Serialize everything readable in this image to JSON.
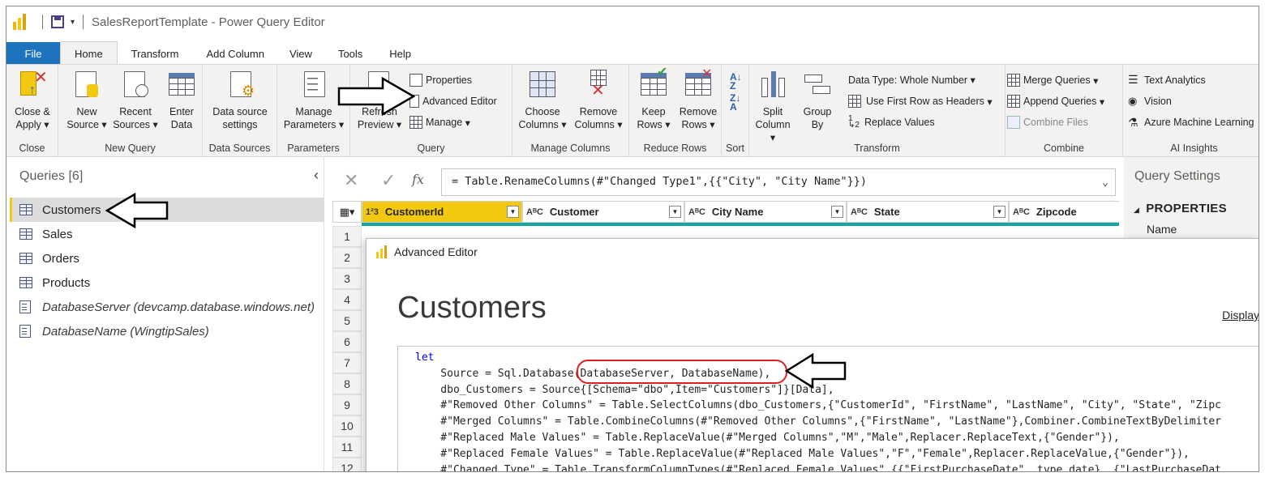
{
  "window": {
    "title": "SalesReportTemplate - Power Query Editor"
  },
  "tabs": [
    "File",
    "Home",
    "Transform",
    "Add Column",
    "View",
    "Tools",
    "Help"
  ],
  "active_tab": "Home",
  "ribbon": {
    "close": {
      "btn1": "Close &",
      "btn1b": "Apply",
      "label": "Close"
    },
    "new_query": {
      "new_source": "New",
      "new_source_b": "Source",
      "recent": "Recent",
      "recent_b": "Sources",
      "enter": "Enter",
      "enter_b": "Data",
      "label": "New Query"
    },
    "data_sources": {
      "settings": "Data source",
      "settings_b": "settings",
      "label": "Data Sources"
    },
    "parameters": {
      "manage": "Manage",
      "manage_b": "Parameters",
      "label": "Parameters"
    },
    "query": {
      "refresh": "Refresh",
      "refresh_b": "Preview",
      "properties": "Properties",
      "advanced_editor": "Advanced Editor",
      "manage": "Manage",
      "label": "Query"
    },
    "manage_columns": {
      "choose": "Choose",
      "choose_b": "Columns",
      "remove": "Remove",
      "remove_b": "Columns",
      "label": "Manage Columns"
    },
    "reduce_rows": {
      "keep": "Keep",
      "keep_b": "Rows",
      "remove": "Remove",
      "remove_b": "Rows",
      "label": "Reduce Rows"
    },
    "sort": {
      "label": "Sort"
    },
    "transform": {
      "split": "Split",
      "split_b": "Column",
      "group": "Group",
      "group_b": "By",
      "data_type": "Data Type: Whole Number",
      "first_row": "Use First Row as Headers",
      "replace": "Replace Values",
      "label": "Transform"
    },
    "combine": {
      "merge": "Merge Queries",
      "append": "Append Queries",
      "combine_files": "Combine Files",
      "label": "Combine"
    },
    "ai": {
      "text": "Text Analytics",
      "vision": "Vision",
      "aml": "Azure Machine Learning",
      "label": "AI Insights"
    }
  },
  "queries": {
    "title": "Queries [6]",
    "items": [
      {
        "name": "Customers",
        "type": "table"
      },
      {
        "name": "Sales",
        "type": "table"
      },
      {
        "name": "Orders",
        "type": "table"
      },
      {
        "name": "Products",
        "type": "table"
      },
      {
        "name": "DatabaseServer (devcamp.database.windows.net)",
        "type": "param"
      },
      {
        "name": "DatabaseName (WingtipSales)",
        "type": "param"
      }
    ]
  },
  "formula": "= Table.RenameColumns(#\"Changed Type1\",{{\"City\", \"City Name\"}})",
  "grid": {
    "columns": [
      {
        "type": "1²3",
        "name": "CustomerId"
      },
      {
        "type": "AᴮC",
        "name": "Customer"
      },
      {
        "type": "AᴮC",
        "name": "City Name"
      },
      {
        "type": "AᴮC",
        "name": "State"
      },
      {
        "type": "AᴮC",
        "name": "Zipcode"
      }
    ],
    "row_numbers": [
      "1",
      "2",
      "3",
      "4",
      "5",
      "6",
      "7",
      "8",
      "9",
      "10",
      "11",
      "12"
    ]
  },
  "query_settings": {
    "title": "Query Settings",
    "properties": "PROPERTIES",
    "name_label": "Name"
  },
  "advanced_editor": {
    "title": "Advanced Editor",
    "query_name": "Customers",
    "display": "Display",
    "code": [
      "let",
      "    Source = Sql.Database(DatabaseServer, DatabaseName),",
      "    dbo_Customers = Source{[Schema=\"dbo\",Item=\"Customers\"]}[Data],",
      "    #\"Removed Other Columns\" = Table.SelectColumns(dbo_Customers,{\"CustomerId\", \"FirstName\", \"LastName\", \"City\", \"State\", \"Zipc",
      "    #\"Merged Columns\" = Table.CombineColumns(#\"Removed Other Columns\",{\"FirstName\", \"LastName\"},Combiner.CombineTextByDelimiter",
      "    #\"Replaced Male Values\" = Table.ReplaceValue(#\"Merged Columns\",\"M\",\"Male\",Replacer.ReplaceText,{\"Gender\"}),",
      "    #\"Replaced Female Values\" = Table.ReplaceValue(#\"Replaced Male Values\",\"F\",\"Female\",Replacer.ReplaceValue,{\"Gender\"}),",
      "    #\"Changed Type\" = Table.TransformColumnTypes(#\"Replaced Female Values\",{{\"FirstPurchaseDate\", type date}, {\"LastPurchaseDat"
    ]
  },
  "colors": {
    "accent": "#f2c811",
    "file_tab": "#1e73be",
    "teal": "#13a89e",
    "highlight_red": "#e02020"
  }
}
